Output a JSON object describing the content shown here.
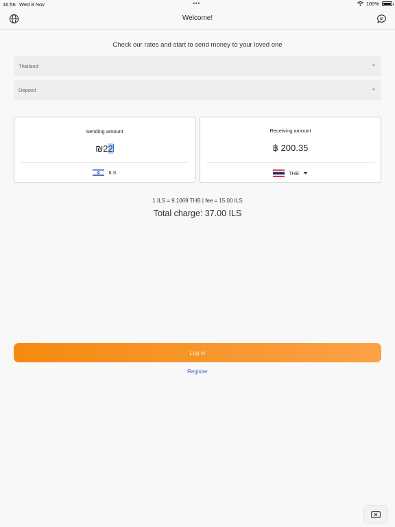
{
  "status_bar": {
    "time": "16:56",
    "date": "Wed 8 Nov",
    "battery": "100%"
  },
  "header": {
    "title": "Welcome!",
    "left_icon": "globe-icon",
    "right_icon": "chat-icon"
  },
  "subtitle": "Check our rates and start to send money to your loved one",
  "country_select": {
    "value": "Thailand"
  },
  "method_select": {
    "value": "Deposit"
  },
  "sending": {
    "label": "Sending amount",
    "symbol": "₪",
    "amount_plain": "2",
    "amount_selected": "2",
    "currency": "ILS",
    "flag": "israel-flag-icon"
  },
  "receiving": {
    "label": "Receiving amount",
    "symbol": "฿",
    "amount": "200.35",
    "currency": "THB",
    "flag": "thailand-flag-icon"
  },
  "rate_line": "1 ILS = 9.1069 THB | fee = 15.00 ILS",
  "total_charge": "Total charge: 37.00 ILS",
  "login_label": "Log in",
  "register_label": "Register",
  "colors": {
    "accent_orange_start": "#f58a0f",
    "accent_orange_end": "#fca147",
    "link_blue": "#4a66c7"
  }
}
